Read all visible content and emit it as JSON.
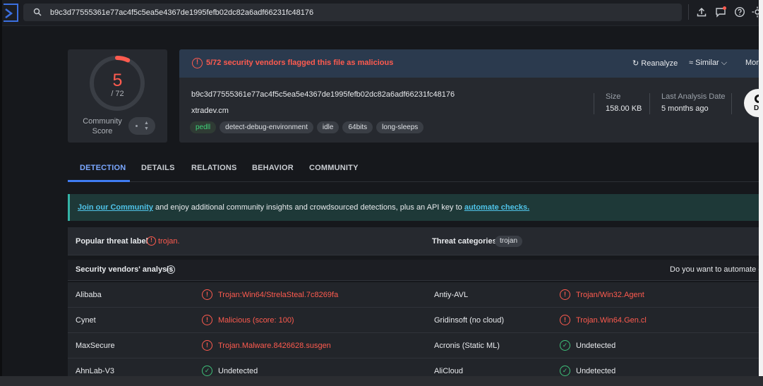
{
  "search": {
    "value": "b9c3d77555361e77ac4f5c5ea5e4367de1995fefb02dc82a6adf66231fc48176"
  },
  "score": {
    "detections": "5",
    "total": "/ 72",
    "community_label_1": "Community",
    "community_label_2": "Score"
  },
  "file": {
    "flag_text": "5/72 security vendors flagged this file as malicious",
    "reanalyze": "Reanalyze",
    "similar": "Similar",
    "more": "More",
    "hash": "b9c3d77555361e77ac4f5c5ea5e4367de1995fefb02dc82a6adf66231fc48176",
    "name": "xtradev.cm",
    "tags": [
      "pedll",
      "detect-debug-environment",
      "idle",
      "64bits",
      "long-sleeps"
    ],
    "size_label": "Size",
    "size_value": "158.00 KB",
    "last_analysis_label": "Last Analysis Date",
    "last_analysis_value": "5 months ago",
    "badge_text": "DL"
  },
  "tabs": [
    "DETECTION",
    "DETAILS",
    "RELATIONS",
    "BEHAVIOR",
    "COMMUNITY"
  ],
  "banner": {
    "link1": "Join our Community",
    "middle": " and enjoy additional community insights and crowdsourced detections, plus an API key to ",
    "link2": "automate checks."
  },
  "threat": {
    "popular_label": "Popular threat label",
    "popular_value": "trojan.",
    "categories_label": "Threat categories",
    "category": "trojan"
  },
  "vendors": {
    "title": "Security vendors' analysis",
    "automate_prompt": "Do you want to automate ch",
    "rows": [
      {
        "v1": "Alibaba",
        "r1": "Trojan:Win64/StrelaSteal.7c8269fa",
        "s1": "bad",
        "v2": "Antiy-AVL",
        "r2": "Trojan/Win32.Agent",
        "s2": "bad"
      },
      {
        "v1": "Cynet",
        "r1": "Malicious (score: 100)",
        "s1": "bad",
        "v2": "Gridinsoft (no cloud)",
        "r2": "Trojan.Win64.Gen.cl",
        "s2": "bad"
      },
      {
        "v1": "MaxSecure",
        "r1": "Trojan.Malware.8426628.susgen",
        "s1": "bad",
        "v2": "Acronis (Static ML)",
        "r2": "Undetected",
        "s2": "ok"
      },
      {
        "v1": "AhnLab-V3",
        "r1": "Undetected",
        "s1": "ok",
        "v2": "AliCloud",
        "r2": "Undetected",
        "s2": "ok"
      }
    ]
  },
  "colors": {
    "malicious": "#ff5b4f",
    "clean": "#3fc27a",
    "accent": "#3f7cf2"
  }
}
